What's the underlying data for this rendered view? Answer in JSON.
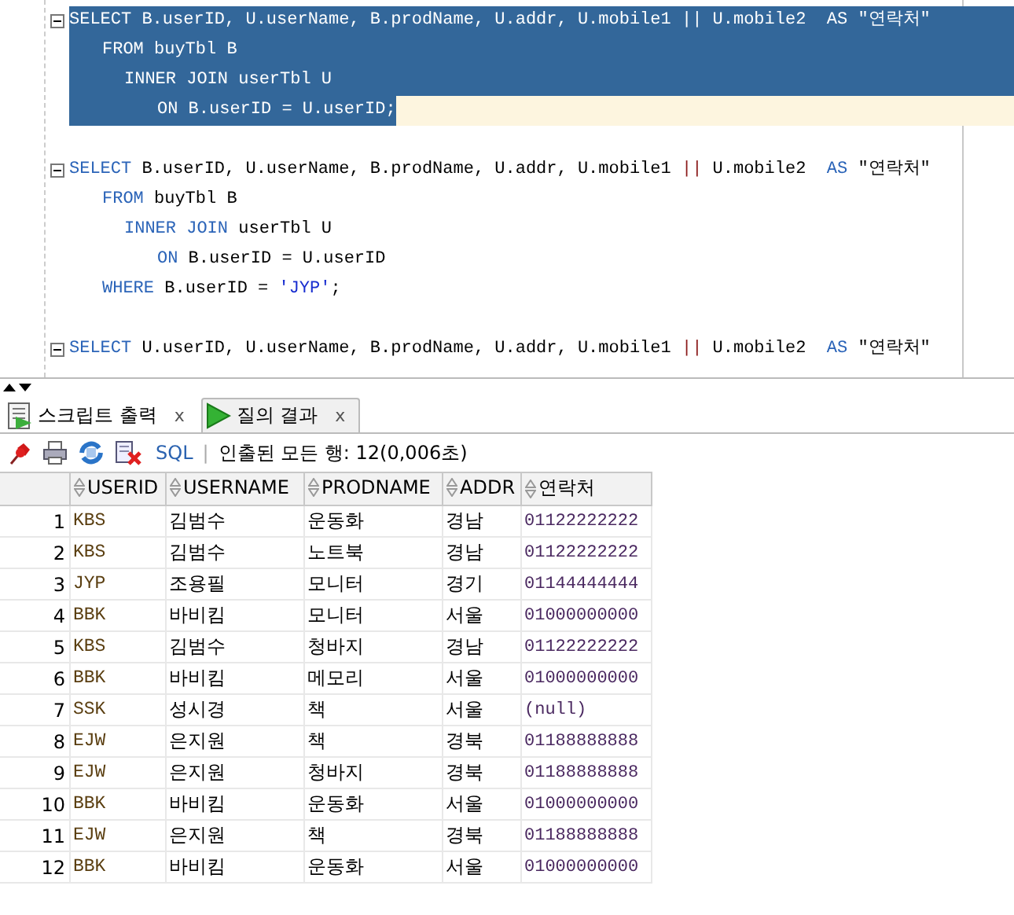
{
  "editor": {
    "statements": [
      {
        "selected": true,
        "lines": [
          {
            "kind": "head",
            "current": false,
            "tokens": [
              {
                "kind": "kw",
                "text": "SELECT"
              },
              {
                "kind": "plain",
                "text": " B.userID, U.userName, B.prodName, U.addr, U.mobile1 "
              },
              {
                "kind": "op",
                "text": "||"
              },
              {
                "kind": "plain",
                "text": " U.mobile2  "
              },
              {
                "kind": "kw",
                "text": "AS"
              },
              {
                "kind": "plain",
                "text": " \"연락처\""
              }
            ]
          },
          {
            "kind": "from",
            "current": false,
            "tokens": [
              {
                "kind": "kw",
                "text": "FROM"
              },
              {
                "kind": "plain",
                "text": " buyTbl B"
              }
            ]
          },
          {
            "kind": "join",
            "current": false,
            "tokens": [
              {
                "kind": "kw",
                "text": "INNER JOIN"
              },
              {
                "kind": "plain",
                "text": " userTbl U"
              }
            ]
          },
          {
            "kind": "on",
            "current": true,
            "tokens": [
              {
                "kind": "kw",
                "text": "ON"
              },
              {
                "kind": "plain",
                "text": " B.userID = U.userID;"
              }
            ]
          }
        ]
      },
      {
        "selected": false,
        "lines": [
          {
            "kind": "head",
            "current": false,
            "tokens": [
              {
                "kind": "kw",
                "text": "SELECT"
              },
              {
                "kind": "plain",
                "text": " B.userID, U.userName, B.prodName, U.addr, U.mobile1 "
              },
              {
                "kind": "op",
                "text": "||"
              },
              {
                "kind": "plain",
                "text": " U.mobile2  "
              },
              {
                "kind": "kw",
                "text": "AS"
              },
              {
                "kind": "plain",
                "text": " \"연락처\""
              }
            ]
          },
          {
            "kind": "from",
            "current": false,
            "tokens": [
              {
                "kind": "kw",
                "text": "FROM"
              },
              {
                "kind": "plain",
                "text": " buyTbl B"
              }
            ]
          },
          {
            "kind": "join",
            "current": false,
            "tokens": [
              {
                "kind": "kw",
                "text": "INNER JOIN"
              },
              {
                "kind": "plain",
                "text": " userTbl U"
              }
            ]
          },
          {
            "kind": "on",
            "current": false,
            "tokens": [
              {
                "kind": "kw",
                "text": "ON"
              },
              {
                "kind": "plain",
                "text": " B.userID = U.userID"
              }
            ]
          },
          {
            "kind": "from",
            "current": false,
            "tokens": [
              {
                "kind": "kw",
                "text": "WHERE"
              },
              {
                "kind": "plain",
                "text": " B.userID = "
              },
              {
                "kind": "str",
                "text": "'JYP'"
              },
              {
                "kind": "plain",
                "text": ";"
              }
            ]
          }
        ]
      },
      {
        "selected": false,
        "lines": [
          {
            "kind": "head",
            "current": false,
            "tokens": [
              {
                "kind": "kw",
                "text": "SELECT"
              },
              {
                "kind": "plain",
                "text": " U.userID, U.userName, B.prodName, U.addr, U.mobile1 "
              },
              {
                "kind": "op",
                "text": "||"
              },
              {
                "kind": "plain",
                "text": " U.mobile2  "
              },
              {
                "kind": "kw",
                "text": "AS"
              },
              {
                "kind": "plain",
                "text": " \"연락처\""
              }
            ]
          }
        ]
      }
    ]
  },
  "tabs": [
    {
      "label": "스크립트 출력",
      "close": "x",
      "selected": false
    },
    {
      "label": "질의 결과",
      "close": "x",
      "selected": true
    }
  ],
  "toolbar": {
    "sql": "SQL",
    "separator": "|",
    "status": "인출된 모든 행: 12(0,006초)"
  },
  "table": {
    "columns": [
      "",
      "USERID",
      "USERNAME",
      "PRODNAME",
      "ADDR",
      "연락처"
    ],
    "rows": [
      [
        "1",
        "KBS",
        "김범수",
        "운동화",
        "경남",
        "01122222222"
      ],
      [
        "2",
        "KBS",
        "김범수",
        "노트북",
        "경남",
        "01122222222"
      ],
      [
        "3",
        "JYP",
        "조용필",
        "모니터",
        "경기",
        "01144444444"
      ],
      [
        "4",
        "BBK",
        "바비킴",
        "모니터",
        "서울",
        "01000000000"
      ],
      [
        "5",
        "KBS",
        "김범수",
        "청바지",
        "경남",
        "01122222222"
      ],
      [
        "6",
        "BBK",
        "바비킴",
        "메모리",
        "서울",
        "01000000000"
      ],
      [
        "7",
        "SSK",
        "성시경",
        "책",
        "서울",
        "(null)"
      ],
      [
        "8",
        "EJW",
        "은지원",
        "책",
        "경북",
        "01188888888"
      ],
      [
        "9",
        "EJW",
        "은지원",
        "청바지",
        "경북",
        "01188888888"
      ],
      [
        "10",
        "BBK",
        "바비킴",
        "운동화",
        "서울",
        "01000000000"
      ],
      [
        "11",
        "EJW",
        "은지원",
        "책",
        "경북",
        "01188888888"
      ],
      [
        "12",
        "BBK",
        "바비킴",
        "운동화",
        "서울",
        "01000000000"
      ]
    ]
  }
}
